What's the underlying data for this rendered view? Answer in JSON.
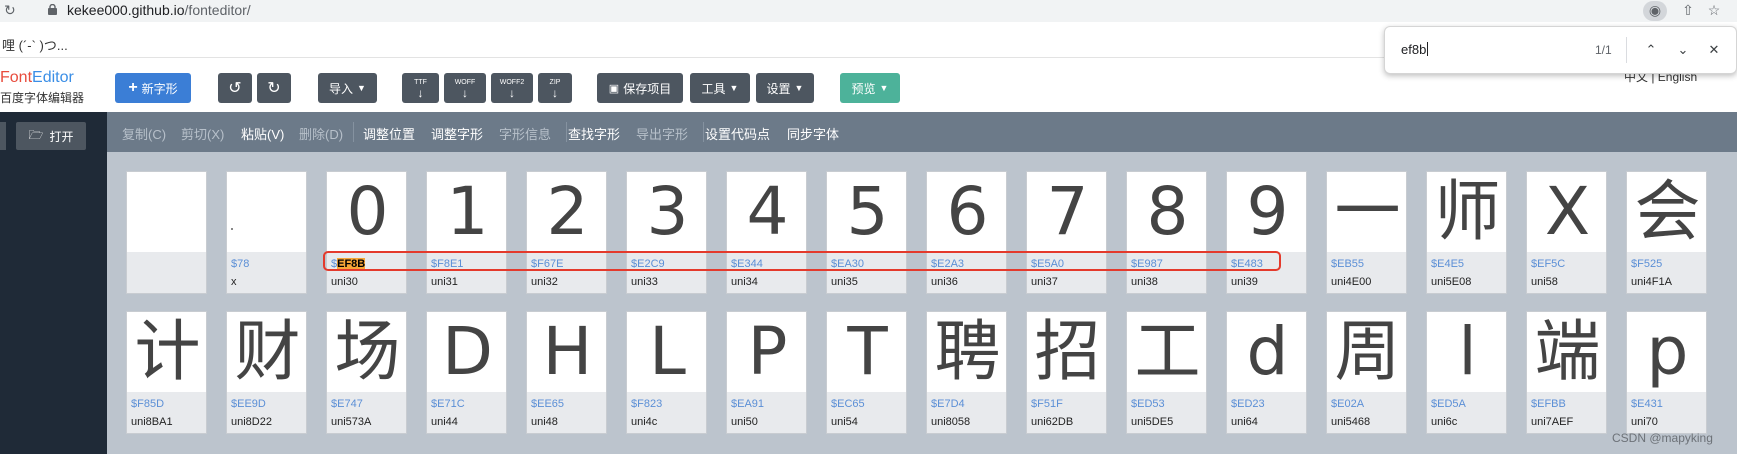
{
  "browser": {
    "url_host": "kekee000.github.io",
    "url_path": "/fonteditor/"
  },
  "bookmark": {
    "label": "哩 (´-` )つ..."
  },
  "find_bar": {
    "query": "ef8b",
    "count": "1/1"
  },
  "app": {
    "logo_font": "Font",
    "logo_editor": "Editor",
    "logo_sub": "百度字体编辑器",
    "lang": "中文 | English",
    "buttons": {
      "new_glyph": "新字形",
      "import": "导入",
      "ttf": "TTF",
      "woff": "WOFF",
      "woff2": "WOFF2",
      "zip": "ZIP",
      "save": "保存项目",
      "tools": "工具",
      "settings": "设置",
      "preview": "预览"
    },
    "open": "打开"
  },
  "actions": [
    {
      "label": "复制(C)",
      "enabled": false
    },
    {
      "label": "剪切(X)",
      "enabled": false
    },
    {
      "label": "粘贴(V)",
      "enabled": true
    },
    {
      "label": "删除(D)",
      "enabled": false
    },
    {
      "label": "调整位置",
      "enabled": true
    },
    {
      "label": "调整字形",
      "enabled": true
    },
    {
      "label": "字形信息",
      "enabled": false
    },
    {
      "label": "查找字形",
      "enabled": true
    },
    {
      "label": "导出字形",
      "enabled": false
    },
    {
      "label": "设置代码点",
      "enabled": true
    },
    {
      "label": "同步字体",
      "enabled": true
    }
  ],
  "glyphs_row1": [
    {
      "glyph": "",
      "code": "",
      "name": ""
    },
    {
      "glyph": "",
      "code": "$78",
      "name": "x"
    },
    {
      "glyph": "0",
      "code": "$EF8B",
      "name": "uni30",
      "highlight": true
    },
    {
      "glyph": "1",
      "code": "$F8E1",
      "name": "uni31"
    },
    {
      "glyph": "2",
      "code": "$F67E",
      "name": "uni32"
    },
    {
      "glyph": "3",
      "code": "$E2C9",
      "name": "uni33"
    },
    {
      "glyph": "4",
      "code": "$E344",
      "name": "uni34"
    },
    {
      "glyph": "5",
      "code": "$EA30",
      "name": "uni35"
    },
    {
      "glyph": "6",
      "code": "$E2A3",
      "name": "uni36"
    },
    {
      "glyph": "7",
      "code": "$E5A0",
      "name": "uni37"
    },
    {
      "glyph": "8",
      "code": "$E987",
      "name": "uni38"
    },
    {
      "glyph": "9",
      "code": "$E483",
      "name": "uni39"
    },
    {
      "glyph": "一",
      "code": "$EB55",
      "name": "uni4E00"
    },
    {
      "glyph": "师",
      "code": "$E4E5",
      "name": "uni5E08"
    },
    {
      "glyph": "X",
      "code": "$EF5C",
      "name": "uni58"
    },
    {
      "glyph": "会",
      "code": "$F525",
      "name": "uni4F1A"
    }
  ],
  "glyphs_row2": [
    {
      "glyph": "计",
      "code": "$F85D",
      "name": "uni8BA1"
    },
    {
      "glyph": "财",
      "code": "$EE9D",
      "name": "uni8D22"
    },
    {
      "glyph": "场",
      "code": "$E747",
      "name": "uni573A"
    },
    {
      "glyph": "D",
      "code": "$E71C",
      "name": "uni44"
    },
    {
      "glyph": "H",
      "code": "$EE65",
      "name": "uni48"
    },
    {
      "glyph": "L",
      "code": "$F823",
      "name": "uni4c"
    },
    {
      "glyph": "P",
      "code": "$EA91",
      "name": "uni50"
    },
    {
      "glyph": "T",
      "code": "$EC65",
      "name": "uni54"
    },
    {
      "glyph": "聘",
      "code": "$E7D4",
      "name": "uni8058"
    },
    {
      "glyph": "招",
      "code": "$F51F",
      "name": "uni62DB"
    },
    {
      "glyph": "工",
      "code": "$ED53",
      "name": "uni5DE5"
    },
    {
      "glyph": "d",
      "code": "$ED23",
      "name": "uni64"
    },
    {
      "glyph": "周",
      "code": "$E02A",
      "name": "uni5468"
    },
    {
      "glyph": "l",
      "code": "$ED5A",
      "name": "uni6c"
    },
    {
      "glyph": "端",
      "code": "$EFBB",
      "name": "uni7AEF"
    },
    {
      "glyph": "p",
      "code": "$E431",
      "name": "uni70"
    }
  ],
  "watermark": "CSDN @mapyking"
}
